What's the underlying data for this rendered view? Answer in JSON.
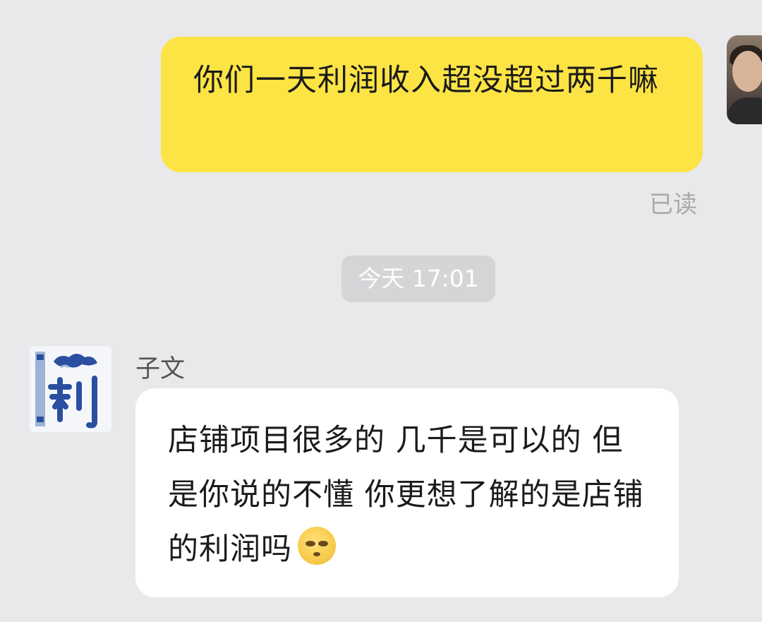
{
  "outgoing": {
    "text": "你们一天利润收入超没超过两千嘛",
    "read_status": "已读"
  },
  "timestamp": "今天 17:01",
  "incoming": {
    "sender_name": "子文",
    "text": "店铺项目很多的 几千是可以的 但是你说的不懂 你更想了解的是店铺的利润吗",
    "emoji": "smiling-face-emoji"
  },
  "colors": {
    "outgoing_bubble": "#fde445",
    "incoming_bubble": "#ffffff",
    "background": "#e9e9eb",
    "timestamp_pill": "#d5d5d8"
  }
}
